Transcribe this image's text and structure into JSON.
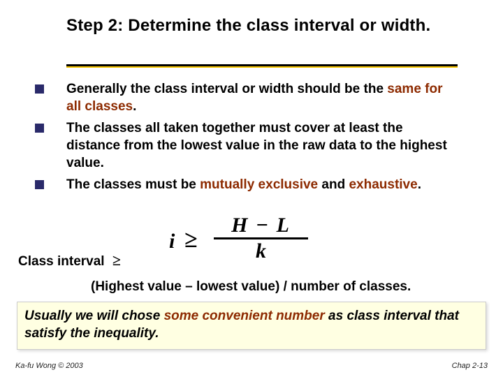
{
  "title": "Step 2: Determine the class interval or width.",
  "bullets": [
    {
      "pre": "Generally the class interval or width should be the ",
      "emph": "same for all classes",
      "post": "."
    },
    {
      "pre": "The classes all taken together must cover at least the distance from the lowest value in the raw data to the highest value.",
      "emph": "",
      "post": ""
    },
    {
      "pre": "The classes must be ",
      "emph": "mutually exclusive",
      "mid": " and ",
      "emph2": "exhaustive",
      "post": "."
    }
  ],
  "formula": {
    "lhs": "i",
    "op": "≥",
    "num": "H − L",
    "den": "k"
  },
  "class_interval_label": "Class interval",
  "class_interval_op": "≥",
  "formula_words": "(Highest value – lowest value) / number of classes.",
  "note": {
    "pre": "Usually we will chose ",
    "emph": "some convenient number",
    "post": " as class interval that satisfy the inequality."
  },
  "footer": {
    "left": "Ka-fu Wong © 2003",
    "right": "Chap 2-13"
  }
}
